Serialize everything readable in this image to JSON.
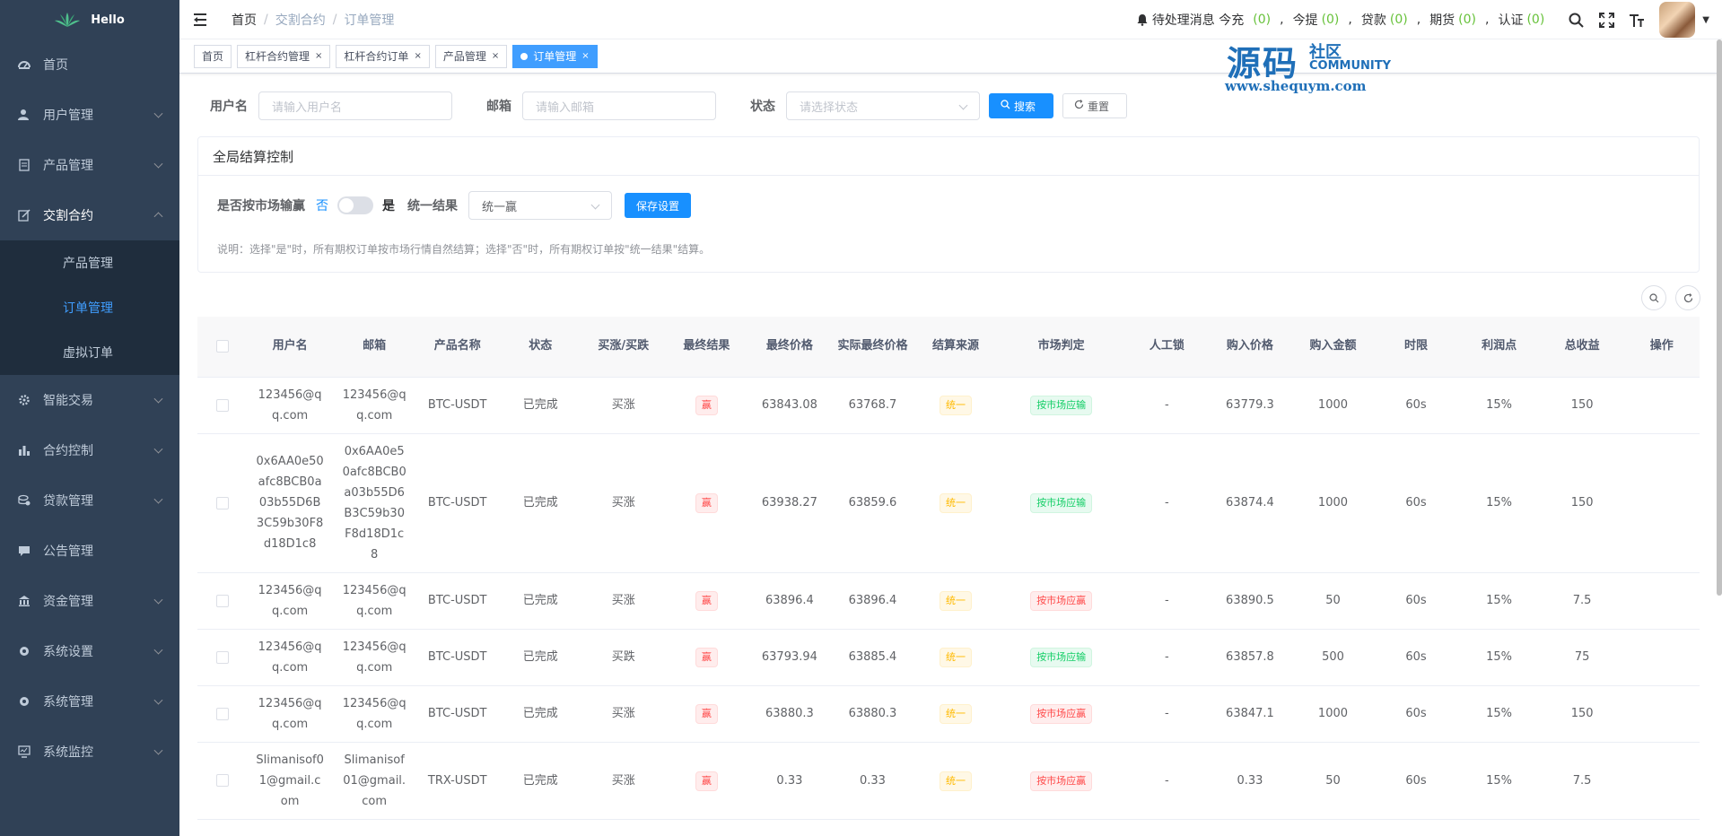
{
  "app": {
    "name": "Hello"
  },
  "sidebar": {
    "items": [
      {
        "label": "首页",
        "icon": "dashboard-icon",
        "expandable": false
      },
      {
        "label": "用户管理",
        "icon": "user-icon",
        "expandable": true
      },
      {
        "label": "产品管理",
        "icon": "document-icon",
        "expandable": true
      },
      {
        "label": "交割合约",
        "icon": "edit-icon",
        "expandable": true,
        "expanded": true
      },
      {
        "label": "智能交易",
        "icon": "gear-icon",
        "expandable": true
      },
      {
        "label": "合约控制",
        "icon": "chart-icon",
        "expandable": true
      },
      {
        "label": "贷款管理",
        "icon": "money-icon",
        "expandable": true
      },
      {
        "label": "公告管理",
        "icon": "message-icon",
        "expandable": false
      },
      {
        "label": "资金管理",
        "icon": "bank-icon",
        "expandable": true
      },
      {
        "label": "系统设置",
        "icon": "settings-icon",
        "expandable": true
      },
      {
        "label": "系统管理",
        "icon": "settings-icon",
        "expandable": true
      },
      {
        "label": "系统监控",
        "icon": "monitor-icon",
        "expandable": true
      }
    ],
    "submenu": [
      {
        "label": "产品管理",
        "active": false
      },
      {
        "label": "订单管理",
        "active": true
      },
      {
        "label": "虚拟订单",
        "active": false
      }
    ]
  },
  "header": {
    "breadcrumb": [
      "首页",
      "交割合约",
      "订单管理"
    ],
    "pending_label": "待处理消息 今充",
    "counts": [
      {
        "label": "今充",
        "value": "(0)"
      },
      {
        "label": "今提",
        "value": "(0)"
      },
      {
        "label": "贷款",
        "value": "(0)"
      },
      {
        "label": "期货",
        "value": "(0)"
      },
      {
        "label": "认证",
        "value": "(0)"
      }
    ]
  },
  "tags": [
    {
      "label": "首页",
      "closable": false,
      "active": false
    },
    {
      "label": "杠杆合约管理",
      "closable": true,
      "active": false
    },
    {
      "label": "杠杆合约订单",
      "closable": true,
      "active": false
    },
    {
      "label": "产品管理",
      "closable": true,
      "active": false
    },
    {
      "label": "订单管理",
      "closable": true,
      "active": true
    }
  ],
  "watermark": {
    "big": "源码",
    "small": "社区",
    "com": "COMMUNITY",
    "url": "www.shequym.com"
  },
  "search": {
    "username_label": "用户名",
    "username_placeholder": "请输入用户名",
    "email_label": "邮箱",
    "email_placeholder": "请输入邮箱",
    "status_label": "状态",
    "status_placeholder": "请选择状态",
    "search_button": "搜索",
    "reset_button": "重置"
  },
  "global_control": {
    "title": "全局结算控制",
    "market_label": "是否按市场输赢",
    "no_label": "否",
    "yes_label": "是",
    "unified_label": "统一结果",
    "unified_value": "统一赢",
    "save_button": "保存设置",
    "note": "说明：选择\"是\"时，所有期权订单按市场行情自然结算；选择\"否\"时，所有期权订单按\"统一结果\"结算。"
  },
  "table": {
    "columns": [
      "用户名",
      "邮箱",
      "产品名称",
      "状态",
      "买涨/买跌",
      "最终结果",
      "最终价格",
      "实际最终价格",
      "结算来源",
      "市场判定",
      "人工锁",
      "购入价格",
      "购入金额",
      "时限",
      "利润点",
      "总收益",
      "操作"
    ],
    "rows": [
      {
        "username": "123456@qq.com",
        "email": "123456@qq.com",
        "product": "BTC-USDT",
        "status": "已完成",
        "direction": "买涨",
        "result": "赢",
        "final_price": "63843.08",
        "actual_price": "63768.7",
        "source": "统一",
        "market": "按市场应输",
        "lock": "-",
        "buy_price": "63779.3",
        "amount": "1000",
        "period": "60s",
        "profit": "15%",
        "total": "150"
      },
      {
        "username": "0x6AA0e50afc8BCB0a03b55D6B3C59b30F8d18D1c8",
        "email": "0x6AA0e50afc8BCB0a03b55D6B3C59b30F8d18D1c8",
        "product": "BTC-USDT",
        "status": "已完成",
        "direction": "买涨",
        "result": "赢",
        "final_price": "63938.27",
        "actual_price": "63859.6",
        "source": "统一",
        "market": "按市场应输",
        "lock": "-",
        "buy_price": "63874.4",
        "amount": "1000",
        "period": "60s",
        "profit": "15%",
        "total": "150"
      },
      {
        "username": "123456@qq.com",
        "email": "123456@qq.com",
        "product": "BTC-USDT",
        "status": "已完成",
        "direction": "买涨",
        "result": "赢",
        "final_price": "63896.4",
        "actual_price": "63896.4",
        "source": "统一",
        "market": "按市场应赢",
        "lock": "-",
        "buy_price": "63890.5",
        "amount": "50",
        "period": "60s",
        "profit": "15%",
        "total": "7.5"
      },
      {
        "username": "123456@qq.com",
        "email": "123456@qq.com",
        "product": "BTC-USDT",
        "status": "已完成",
        "direction": "买跌",
        "result": "赢",
        "final_price": "63793.94",
        "actual_price": "63885.4",
        "source": "统一",
        "market": "按市场应输",
        "lock": "-",
        "buy_price": "63857.8",
        "amount": "500",
        "period": "60s",
        "profit": "15%",
        "total": "75"
      },
      {
        "username": "123456@qq.com",
        "email": "123456@qq.com",
        "product": "BTC-USDT",
        "status": "已完成",
        "direction": "买涨",
        "result": "赢",
        "final_price": "63880.3",
        "actual_price": "63880.3",
        "source": "统一",
        "market": "按市场应赢",
        "lock": "-",
        "buy_price": "63847.1",
        "amount": "1000",
        "period": "60s",
        "profit": "15%",
        "total": "150"
      },
      {
        "username": "Slimanisof01@gmail.com",
        "email": "Slimanisof01@gmail.com",
        "product": "TRX-USDT",
        "status": "已完成",
        "direction": "买涨",
        "result": "赢",
        "final_price": "0.33",
        "actual_price": "0.33",
        "source": "统一",
        "market": "按市场应赢",
        "lock": "-",
        "buy_price": "0.33",
        "amount": "50",
        "period": "60s",
        "profit": "15%",
        "total": "7.5"
      }
    ]
  },
  "colors": {
    "sidebar_bg": "#304156",
    "submenu_bg": "#1f2d3d",
    "accent": "#1890ff",
    "active_sub": "#409eff",
    "count_green": "#67c23a"
  }
}
